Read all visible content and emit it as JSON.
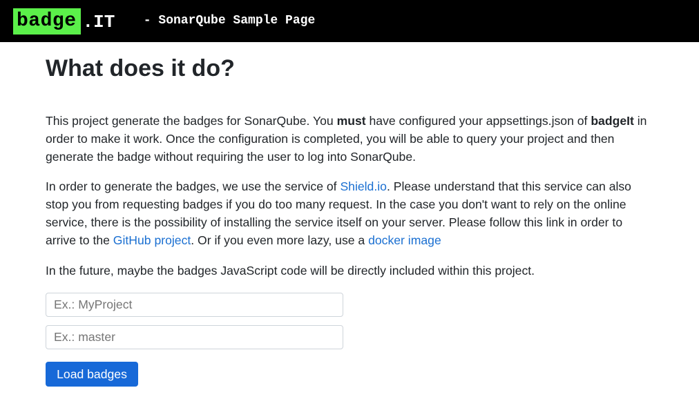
{
  "navbar": {
    "brand_badge": "badge",
    "brand_suffix": ".IT",
    "title": " - SonarQube Sample Page",
    "brand_color": "#5bf04a"
  },
  "main": {
    "heading": "What does it do?",
    "paragraph1": {
      "t1": "This project generate the badges for SonarQube. You ",
      "bold1": "must",
      "t2": " have configured your appsettings.json of ",
      "bold2": "badgeIt",
      "t3": " in order to make it work. Once the configuration is completed, you will be able to query your project and then generate the badge without requiring the user to log into SonarQube."
    },
    "paragraph2": {
      "t1": "In order to generate the badges, we use the service of ",
      "link1": "Shield.io",
      "t2": ". Please understand that this service can also stop you from requesting badges if you do too many request. In the case you don't want to rely on the online service, there is the possibility of installing the service itself on your server. Please follow this link in order to arrive to the ",
      "link2": "GitHub project",
      "t3": ". Or if you even more lazy, use a ",
      "link3": "docker image"
    },
    "paragraph3": "In the future, maybe the badges JavaScript code will be directly included within this project."
  },
  "form": {
    "project_input": {
      "value": "",
      "placeholder": "Ex.: MyProject"
    },
    "branch_input": {
      "value": "",
      "placeholder": "Ex.: master"
    },
    "load_button_label": "Load badges"
  },
  "colors": {
    "link": "#1a6fd1",
    "button": "#1769d8",
    "navbar": "#000000"
  }
}
